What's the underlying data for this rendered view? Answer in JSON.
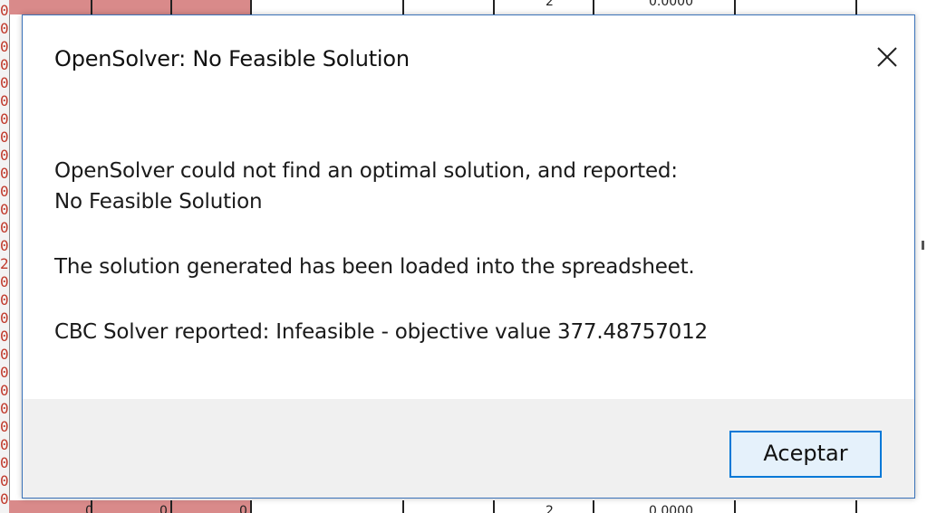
{
  "background": {
    "row_numbers": [
      "0",
      "0",
      "0",
      "0",
      "0",
      "0",
      "0",
      "0",
      "0",
      "0",
      "0",
      "0",
      "0",
      "0",
      "2",
      "0",
      "0",
      "0",
      "0",
      "0",
      "0",
      "0",
      "0",
      "0",
      "0",
      "0",
      "0",
      "0"
    ],
    "top_strip_values": [
      "2",
      "0.0000"
    ],
    "bottom_strip_values": [
      "0",
      "0",
      "0",
      "2",
      "0.0000"
    ]
  },
  "dialog": {
    "title": "OpenSolver: No Feasible Solution",
    "close_icon": "close-icon",
    "messages": {
      "line1": "OpenSolver could not find an optimal solution, and reported:",
      "line2": "No Feasible Solution",
      "line3": "The solution generated has been loaded into the spreadsheet.",
      "line4": "CBC Solver reported: Infeasible - objective value 377.48757012"
    },
    "ok_button_label": "Aceptar"
  },
  "colors": {
    "accent": "#0078d7",
    "dialog_border": "#3b73b9",
    "footer_bg": "#f0f0f0",
    "cell_red": "#d98a8a"
  }
}
